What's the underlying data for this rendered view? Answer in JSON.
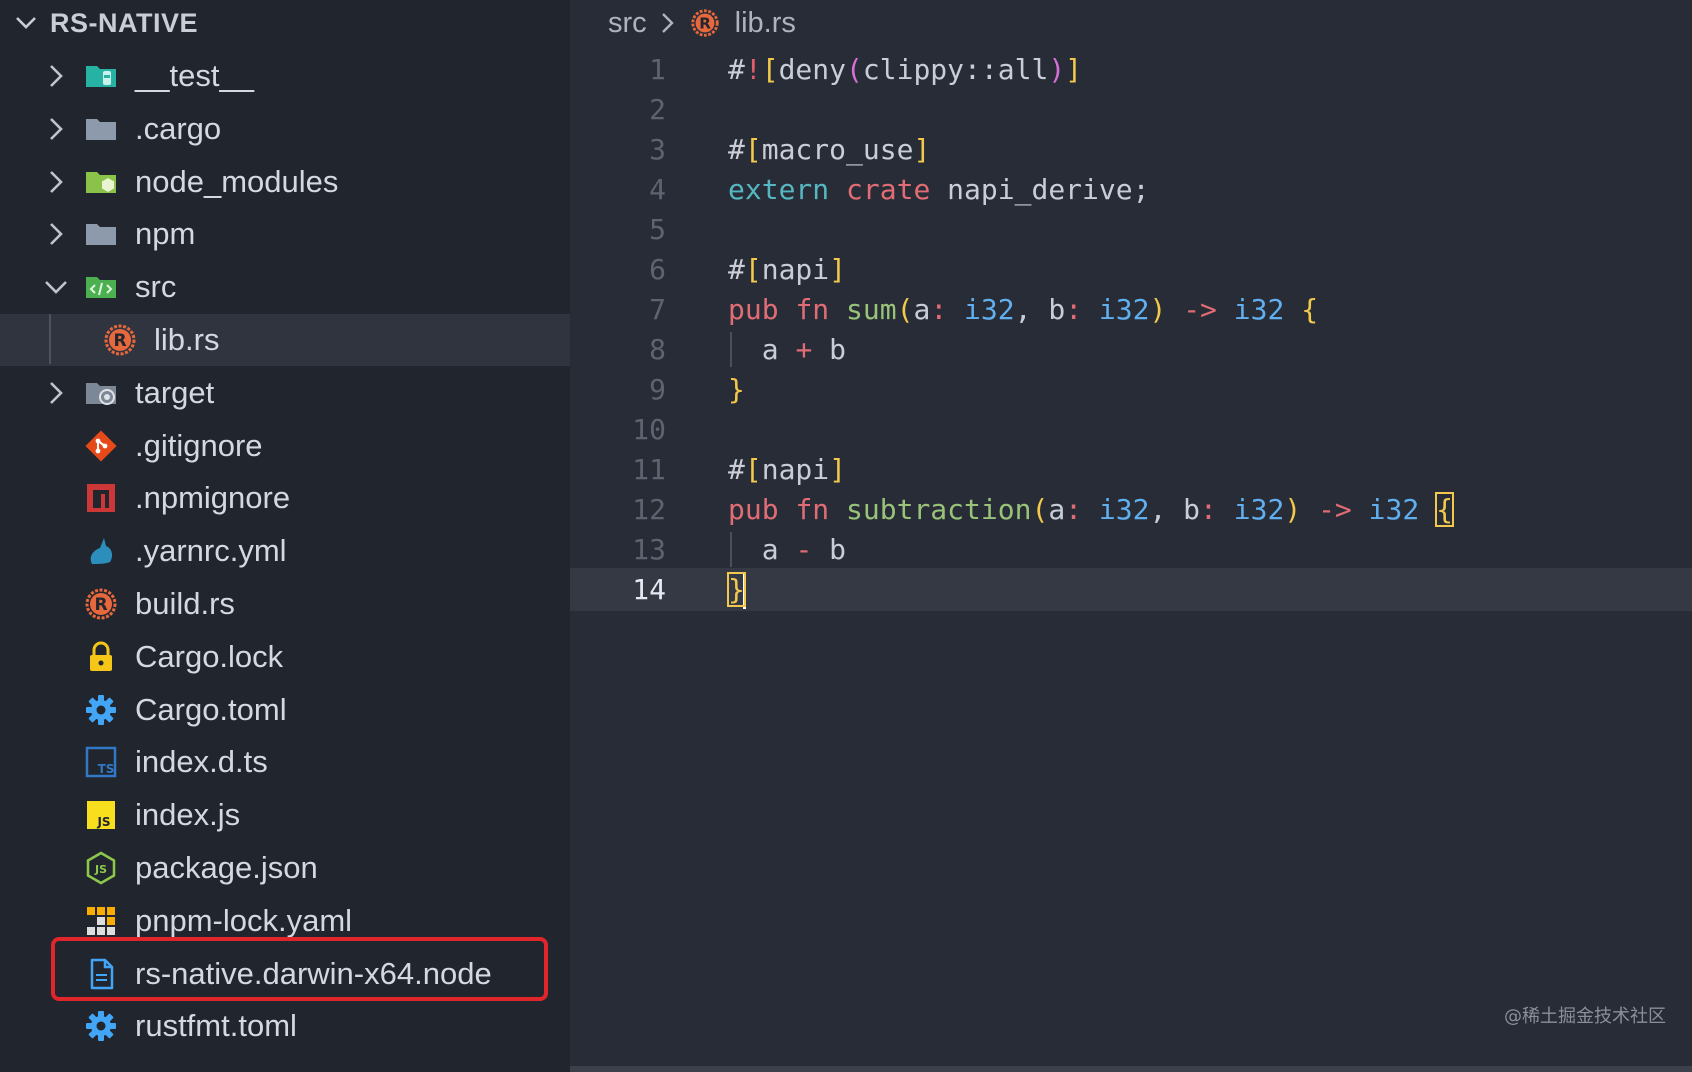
{
  "explorer": {
    "title": "RS-NATIVE",
    "items": [
      {
        "label": "__test__",
        "icon": "test-folder-icon",
        "expandable": true,
        "expanded": false
      },
      {
        "label": ".cargo",
        "icon": "folder-icon",
        "expandable": true,
        "expanded": false
      },
      {
        "label": "node_modules",
        "icon": "node-folder-icon",
        "expandable": true,
        "expanded": false
      },
      {
        "label": "npm",
        "icon": "folder-icon",
        "expandable": true,
        "expanded": false
      },
      {
        "label": "src",
        "icon": "src-folder-icon",
        "expandable": true,
        "expanded": true
      },
      {
        "label": "lib.rs",
        "icon": "rust-file-icon",
        "child": true,
        "selected": true
      },
      {
        "label": "target",
        "icon": "target-folder-icon",
        "expandable": true,
        "expanded": false
      },
      {
        "label": ".gitignore",
        "icon": "git-icon"
      },
      {
        "label": ".npmignore",
        "icon": "npm-icon"
      },
      {
        "label": ".yarnrc.yml",
        "icon": "yarn-icon"
      },
      {
        "label": "build.rs",
        "icon": "rust-file-icon"
      },
      {
        "label": "Cargo.lock",
        "icon": "lock-icon"
      },
      {
        "label": "Cargo.toml",
        "icon": "gear-icon"
      },
      {
        "label": "index.d.ts",
        "icon": "typescript-icon"
      },
      {
        "label": "index.js",
        "icon": "javascript-icon"
      },
      {
        "label": "package.json",
        "icon": "nodejs-icon"
      },
      {
        "label": "pnpm-lock.yaml",
        "icon": "pnpm-icon"
      },
      {
        "label": "rs-native.darwin-x64.node",
        "icon": "file-icon",
        "highlighted": true
      },
      {
        "label": "rustfmt.toml",
        "icon": "gear-icon"
      }
    ]
  },
  "breadcrumb": {
    "folder": "src",
    "file": "lib.rs"
  },
  "editor": {
    "active_line": 14,
    "lines": [
      {
        "n": "1",
        "tokens": [
          [
            "#",
            "hash"
          ],
          [
            "!",
            "bang"
          ],
          [
            "[",
            "b1"
          ],
          [
            "deny",
            "plain"
          ],
          [
            "(",
            "b2"
          ],
          [
            "clippy::all",
            "plain"
          ],
          [
            ")",
            "b2"
          ],
          [
            "]",
            "b1"
          ]
        ]
      },
      {
        "n": "2",
        "tokens": []
      },
      {
        "n": "3",
        "tokens": [
          [
            "#",
            "hash"
          ],
          [
            "[",
            "b1"
          ],
          [
            "macro_use",
            "plain"
          ],
          [
            "]",
            "b1"
          ]
        ]
      },
      {
        "n": "4",
        "tokens": [
          [
            "extern",
            "kw-blue"
          ],
          [
            " ",
            "plain"
          ],
          [
            "crate",
            "kw-red"
          ],
          [
            " napi_derive;",
            "plain"
          ]
        ]
      },
      {
        "n": "5",
        "tokens": []
      },
      {
        "n": "6",
        "tokens": [
          [
            "#",
            "hash"
          ],
          [
            "[",
            "b1"
          ],
          [
            "napi",
            "plain"
          ],
          [
            "]",
            "b1"
          ]
        ]
      },
      {
        "n": "7",
        "tokens": [
          [
            "pub",
            "kw-red"
          ],
          [
            " ",
            "plain"
          ],
          [
            "fn",
            "kw-red"
          ],
          [
            " ",
            "plain"
          ],
          [
            "sum",
            "fn"
          ],
          [
            "(",
            "b1"
          ],
          [
            "a",
            "plain"
          ],
          [
            ":",
            "op"
          ],
          [
            " ",
            "plain"
          ],
          [
            "i32",
            "type"
          ],
          [
            ", b",
            "plain"
          ],
          [
            ":",
            "op"
          ],
          [
            " ",
            "plain"
          ],
          [
            "i32",
            "type"
          ],
          [
            ")",
            "b1"
          ],
          [
            " ",
            "plain"
          ],
          [
            "->",
            "op"
          ],
          [
            " ",
            "plain"
          ],
          [
            "i32",
            "type"
          ],
          [
            " ",
            "plain"
          ],
          [
            "{",
            "b1"
          ]
        ]
      },
      {
        "n": "8",
        "guide": true,
        "tokens": [
          [
            "  a ",
            "plain"
          ],
          [
            "+",
            "op"
          ],
          [
            " b",
            "plain"
          ]
        ]
      },
      {
        "n": "9",
        "tokens": [
          [
            "}",
            "b1"
          ]
        ]
      },
      {
        "n": "10",
        "tokens": []
      },
      {
        "n": "11",
        "tokens": [
          [
            "#",
            "hash"
          ],
          [
            "[",
            "b1"
          ],
          [
            "napi",
            "plain"
          ],
          [
            "]",
            "b1"
          ]
        ]
      },
      {
        "n": "12",
        "tokens": [
          [
            "pub",
            "kw-red"
          ],
          [
            " ",
            "plain"
          ],
          [
            "fn",
            "kw-red"
          ],
          [
            " ",
            "plain"
          ],
          [
            "subtraction",
            "fn"
          ],
          [
            "(",
            "b1"
          ],
          [
            "a",
            "plain"
          ],
          [
            ":",
            "op"
          ],
          [
            " ",
            "plain"
          ],
          [
            "i32",
            "type"
          ],
          [
            ", b",
            "plain"
          ],
          [
            ":",
            "op"
          ],
          [
            " ",
            "plain"
          ],
          [
            "i32",
            "type"
          ],
          [
            ")",
            "b1"
          ],
          [
            " ",
            "plain"
          ],
          [
            "->",
            "op"
          ],
          [
            " ",
            "plain"
          ],
          [
            "i32",
            "type"
          ],
          [
            " ",
            "plain"
          ],
          [
            "{",
            "b1-match"
          ]
        ]
      },
      {
        "n": "13",
        "guide": true,
        "tokens": [
          [
            "  a ",
            "plain"
          ],
          [
            "-",
            "op"
          ],
          [
            " b",
            "plain"
          ]
        ]
      },
      {
        "n": "14",
        "tokens": [
          [
            "}",
            "b1-match"
          ],
          [
            "",
            "cursor"
          ]
        ]
      }
    ]
  },
  "watermark": "@稀土掘金技术社区",
  "colors": {
    "sidebar_bg": "#21252d",
    "editor_bg": "#282c36",
    "highlight_border": "#e0262b",
    "selected_row": "#2f343e"
  }
}
